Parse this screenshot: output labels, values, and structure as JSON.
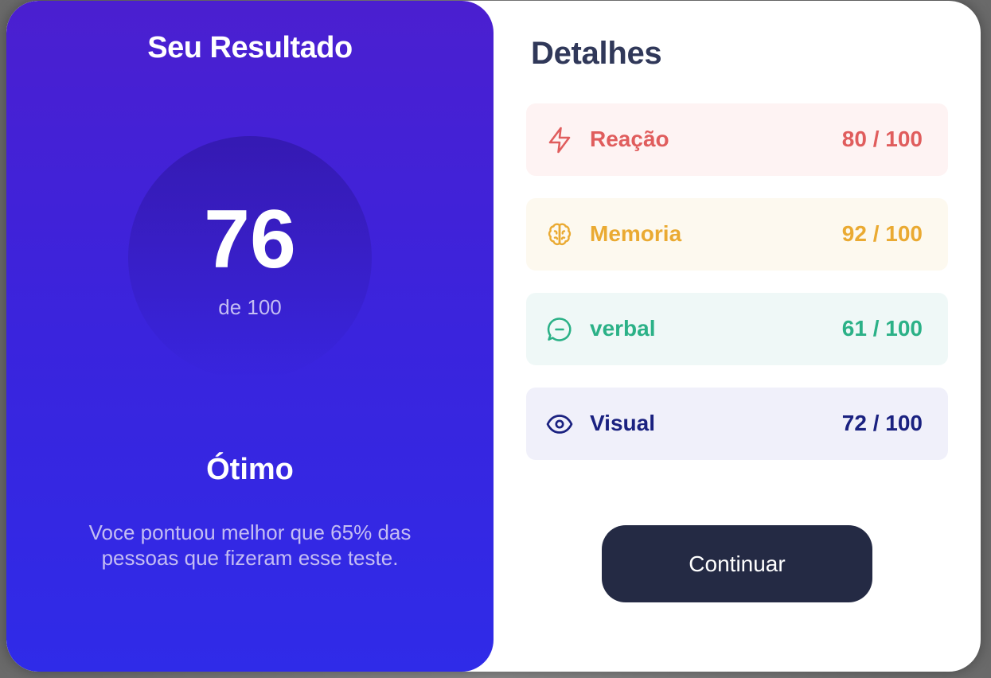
{
  "result": {
    "title": "Seu Resultado",
    "score": "76",
    "score_max": "de 100",
    "rating": "Ótimo",
    "description": "Voce pontuou melhor que 65% das pessoas que fizeram esse teste."
  },
  "details": {
    "title": "Detalhes",
    "items": [
      {
        "label": "Reação",
        "value": "80 / 100",
        "icon": "lightning-icon",
        "color": "#e05d5d",
        "bg": "#fef3f3"
      },
      {
        "label": "Memoria",
        "value": "92 / 100",
        "icon": "brain-icon",
        "color": "#eaaa32",
        "bg": "#fdf9ef"
      },
      {
        "label": "verbal",
        "value": "61 / 100",
        "icon": "chat-icon",
        "color": "#2bb187",
        "bg": "#eff8f7"
      },
      {
        "label": "Visual",
        "value": "72 / 100",
        "icon": "eye-icon",
        "color": "#1a2180",
        "bg": "#f0f0fa"
      }
    ]
  },
  "actions": {
    "continue_label": "Continuar"
  },
  "colors": {
    "panel_gradient_top": "#4b1fd0",
    "panel_gradient_bottom": "#2f2be8",
    "button_bg": "#242a44",
    "heading": "#303859"
  }
}
